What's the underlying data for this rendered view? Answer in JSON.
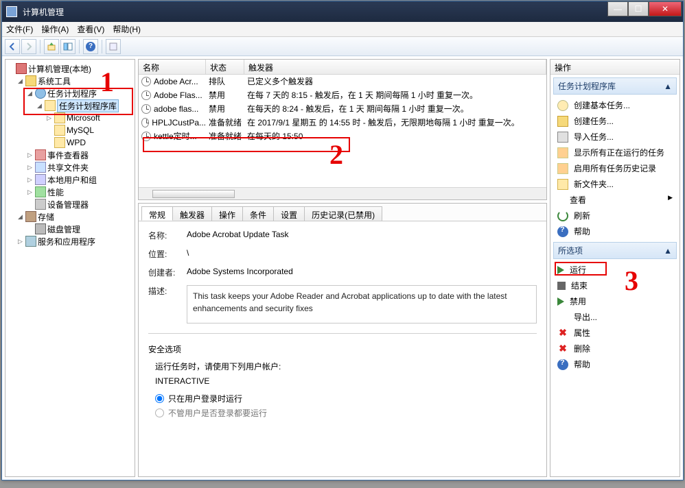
{
  "window": {
    "title": "计算机管理"
  },
  "menu": {
    "file": "文件(F)",
    "action": "操作(A)",
    "view": "查看(V)",
    "help": "帮助(H)"
  },
  "tree": {
    "root": "计算机管理(本地)",
    "systools": "系统工具",
    "scheduler": "任务计划程序",
    "schedlib": "任务计划程序库",
    "microsoft": "Microsoft",
    "mysql": "MySQL",
    "wpd": "WPD",
    "eventviewer": "事件查看器",
    "sharedfolders": "共享文件夹",
    "localusers": "本地用户和组",
    "performance": "性能",
    "devmgr": "设备管理器",
    "storage": "存储",
    "diskmgmt": "磁盘管理",
    "services": "服务和应用程序"
  },
  "columns": {
    "name": "名称",
    "state": "状态",
    "trigger": "触发器"
  },
  "tasks": [
    {
      "name": "Adobe Acr...",
      "state": "排队",
      "trigger": "已定义多个触发器"
    },
    {
      "name": "Adobe Flas...",
      "state": "禁用",
      "trigger": "在每 7 天的 8:15 - 触发后，在 1 天 期间每隔 1 小时 重复一次。"
    },
    {
      "name": "adobe flas...",
      "state": "禁用",
      "trigger": "在每天的 8:24 - 触发后，在 1 天 期间每隔 1 小时 重复一次。"
    },
    {
      "name": "HPLJCustPa...",
      "state": "准备就绪",
      "trigger": "在 2017/9/1 星期五 的 14:55 时 - 触发后，无限期地每隔 1 小时 重复一次。"
    },
    {
      "name": "kettle定时...",
      "state": "准备就绪",
      "trigger": "在每天的 15:50"
    }
  ],
  "tabs": {
    "general": "常规",
    "triggers": "触发器",
    "actions": "操作",
    "conditions": "条件",
    "settings": "设置",
    "history": "历史记录(已禁用)"
  },
  "detail": {
    "name_label": "名称:",
    "name": "Adobe Acrobat Update Task",
    "location_label": "位置:",
    "location": "\\",
    "author_label": "创建者:",
    "author": "Adobe Systems Incorporated",
    "desc_label": "描述:",
    "desc": "This task keeps your Adobe Reader and Acrobat applications up to date with the latest enhancements and security fixes",
    "sec_header": "安全选项",
    "runas_label": "运行任务时，请使用下列用户帐户:",
    "runas_value": "INTERACTIVE",
    "radio1": "只在用户登录时运行",
    "radio2": "不管用户是否登录都要运行"
  },
  "actions": {
    "panel_title": "操作",
    "section1": "任务计划程序库",
    "create_basic": "创建基本任务...",
    "create_task": "创建任务...",
    "import": "导入任务...",
    "show_running": "显示所有正在运行的任务",
    "enable_history": "启用所有任务历史记录",
    "new_folder": "新文件夹...",
    "view": "查看",
    "refresh": "刷新",
    "help": "帮助",
    "section2": "所选项",
    "run": "运行",
    "end": "结束",
    "disable": "禁用",
    "export": "导出...",
    "properties": "属性",
    "delete": "删除",
    "help2": "帮助"
  },
  "annotations": {
    "one": "1",
    "two": "2",
    "three": "3"
  }
}
